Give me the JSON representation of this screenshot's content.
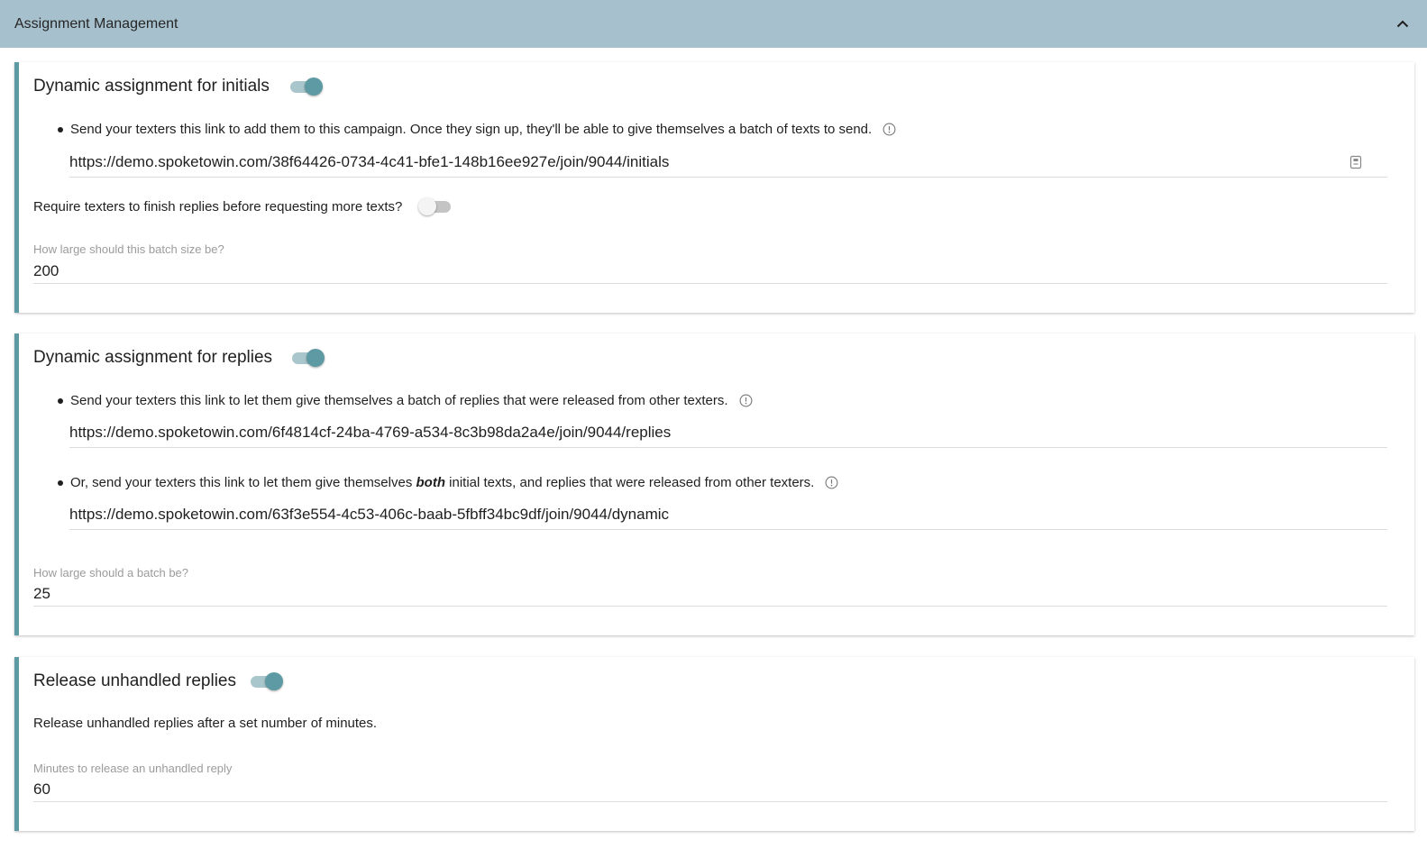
{
  "header": {
    "title": "Assignment Management",
    "collapse_icon": "chevron-up-icon"
  },
  "initials_card": {
    "title": "Dynamic assignment for initials",
    "toggle_on": true,
    "bullet_text": "Send your texters this link to add them to this campaign. Once they sign up, they'll be able to give themselves a batch of texts to send.",
    "link": "https://demo.spoketowin.com/38f64426-0734-4c41-bfe1-148b16ee927e/join/9044/initials",
    "require_text": "Require texters to finish replies before requesting more texts?",
    "require_toggle_on": false,
    "batch_label": "How large should this batch size be?",
    "batch_value": "200"
  },
  "replies_card": {
    "title": "Dynamic assignment for replies",
    "toggle_on": true,
    "bullet1_text": "Send your texters this link to let them give themselves a batch of replies that were released from other texters.",
    "link1": "https://demo.spoketowin.com/6f4814cf-24ba-4769-a534-8c3b98da2a4e/join/9044/replies",
    "bullet2_before": "Or, send your texters this link to let them give themselves ",
    "bullet2_emphasis": "both",
    "bullet2_after": " initial texts, and replies that were released from other texters.",
    "link2": "https://demo.spoketowin.com/63f3e554-4c53-406c-baab-5fbff34bc9df/join/9044/dynamic",
    "batch_label": "How large should a batch be?",
    "batch_value": "25"
  },
  "release_card": {
    "title": "Release unhandled replies",
    "toggle_on": true,
    "description": "Release unhandled replies after a set number of minutes.",
    "minutes_label": "Minutes to release an unhandled reply",
    "minutes_value": "60"
  },
  "colors": {
    "accent": "#5e9aa4",
    "header_bg": "#a7c0cd"
  }
}
